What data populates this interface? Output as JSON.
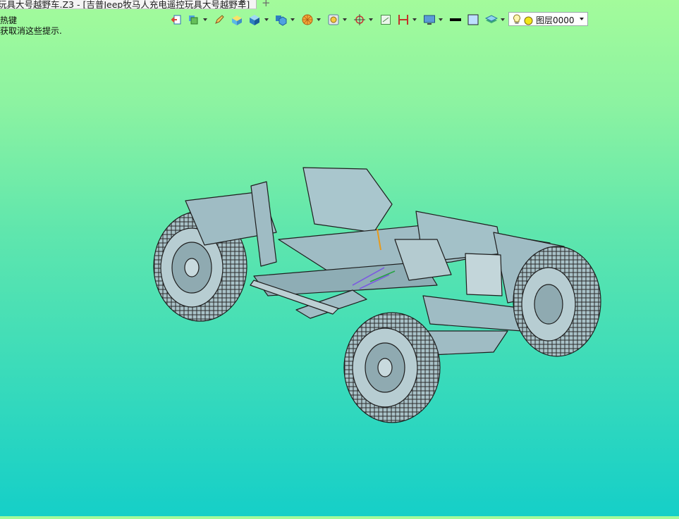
{
  "window": {
    "tab_title": "玩具大号越野车.Z3 - [吉普Jeep牧马人充电遥控玩具大号越野车]",
    "close_glyph": "✕",
    "new_tab_glyph": "+"
  },
  "hints": {
    "line1": "热键",
    "line2": "获取消这些提示."
  },
  "toolbar": {
    "icons": [
      "exit-icon",
      "layer-manager-icon",
      "pencil-icon",
      "box-shade-icon",
      "cube-icon",
      "multi-cube-icon",
      "sphere-render-icon",
      "view-icon",
      "crosshair-icon",
      "fit-window-icon",
      "measure-icon",
      "monitor-icon",
      "line-color-icon",
      "fill-color-icon",
      "layers-icon"
    ],
    "layer": {
      "label": "图层0000",
      "bulb_icon": "lightbulb-icon",
      "color_icon": "layer-color-icon",
      "color": "#f1e51a"
    }
  },
  "viewport": {
    "description_model": "jeep-rc-chassis-model",
    "model_color": "#9fbcc4",
    "bg_top": "#a3fb9b",
    "bg_bottom": "#15cfc8"
  }
}
